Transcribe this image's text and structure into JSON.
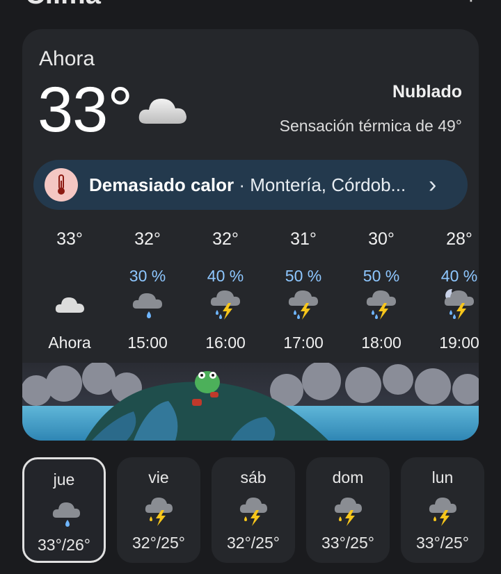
{
  "header": {
    "title": "Clima",
    "more_glyph": "⋮"
  },
  "now": {
    "label": "Ahora",
    "temperature": "33°",
    "condition": "Nublado",
    "feels_like": "Sensación térmica de 49°",
    "icon": "cloud-icon"
  },
  "alert": {
    "title": "Demasiado calor",
    "separator": " · ",
    "location": "Montería, Córdob...",
    "icon": "thermometer-icon"
  },
  "hourly": [
    {
      "temp": "33°",
      "precip": "",
      "time": "Ahora",
      "icon": "cloud-icon"
    },
    {
      "temp": "32°",
      "precip": "30 %",
      "time": "15:00",
      "icon": "rain-cloud-icon"
    },
    {
      "temp": "32°",
      "precip": "40 %",
      "time": "16:00",
      "icon": "thunderstorm-icon"
    },
    {
      "temp": "31°",
      "precip": "50 %",
      "time": "17:00",
      "icon": "thunderstorm-icon"
    },
    {
      "temp": "30°",
      "precip": "50 %",
      "time": "18:00",
      "icon": "thunderstorm-icon"
    },
    {
      "temp": "28°",
      "precip": "40 %",
      "time": "19:00",
      "icon": "night-thunderstorm-icon"
    }
  ],
  "daily": [
    {
      "day": "jue",
      "range": "33°/26°",
      "icon": "rain-cloud-icon",
      "selected": true
    },
    {
      "day": "vie",
      "range": "32°/25°",
      "icon": "thunderstorm-icon"
    },
    {
      "day": "sáb",
      "range": "32°/25°",
      "icon": "thunderstorm-icon"
    },
    {
      "day": "dom",
      "range": "33°/25°",
      "icon": "thunderstorm-icon"
    },
    {
      "day": "lun",
      "range": "33°/25°",
      "icon": "thunderstorm-icon"
    }
  ],
  "colors": {
    "background": "#1a1b1e",
    "card": "#25272b",
    "alert_bg": "#23394d",
    "precip": "#8ec7ff",
    "bolt": "#f7c61b"
  }
}
